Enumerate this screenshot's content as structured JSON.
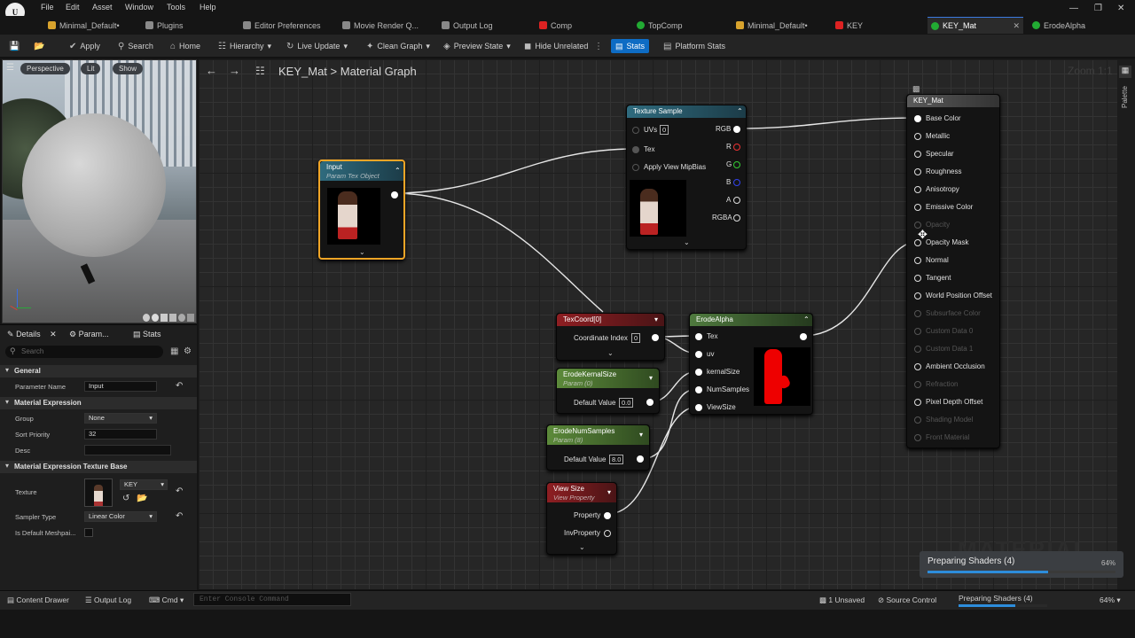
{
  "menu": {
    "items": [
      "File",
      "Edit",
      "Asset",
      "Window",
      "Tools",
      "Help"
    ],
    "logo": "U"
  },
  "tabs": [
    {
      "label": "Minimal_Default•",
      "icon": "level-icon"
    },
    {
      "label": "Plugins",
      "icon": "plug-icon"
    },
    {
      "label": "Editor Preferences",
      "icon": "settings-icon"
    },
    {
      "label": "Movie Render Q...",
      "icon": "movie-icon"
    },
    {
      "label": "Output Log",
      "icon": "log-icon"
    },
    {
      "label": "Comp",
      "icon": "comp-icon"
    },
    {
      "label": "TopComp",
      "icon": "comp-icon"
    },
    {
      "label": "Minimal_Default•",
      "icon": "level-icon"
    },
    {
      "label": "KEY",
      "icon": "comp-icon"
    },
    {
      "label": "KEY_Mat",
      "icon": "material-icon",
      "active": true
    },
    {
      "label": "ErodeAlpha",
      "icon": "material-icon"
    }
  ],
  "toolbar": {
    "apply": "Apply",
    "search": "Search",
    "home": "Home",
    "hierarchy": "Hierarchy",
    "live_update": "Live Update",
    "clean_graph": "Clean Graph",
    "preview_state": "Preview State",
    "hide_unrelated": "Hide Unrelated",
    "stats": "Stats",
    "platform_stats": "Platform Stats"
  },
  "viewport": {
    "perspective": "Perspective",
    "lit": "Lit",
    "show": "Show"
  },
  "details": {
    "tabs": [
      "Details",
      "Param...",
      "Stats"
    ],
    "search_placeholder": "Search",
    "sections": {
      "general": "General",
      "material_expression": "Material Expression",
      "texture_base": "Material Expression Texture Base"
    },
    "props": {
      "parameter_name_label": "Parameter Name",
      "parameter_name": "Input",
      "group_label": "Group",
      "group": "None",
      "sort_priority_label": "Sort Priority",
      "sort_priority": "32",
      "desc_label": "Desc",
      "texture_label": "Texture",
      "texture": "KEY",
      "sampler_label": "Sampler Type",
      "sampler": "Linear Color",
      "default_meshpaint_label": "Is Default Meshpai..."
    }
  },
  "graph": {
    "breadcrumb_root": "KEY_Mat",
    "breadcrumb_sep": ">",
    "breadcrumb_leaf": "Material Graph",
    "zoom": "Zoom 1:1",
    "palette": "Palette"
  },
  "nodes": {
    "input": {
      "title": "Input",
      "subtitle": "Param Tex Object"
    },
    "texture_sample": {
      "title": "Texture Sample",
      "uvs": "UVs",
      "uvs_val": "0",
      "tex": "Tex",
      "mip": "Apply View MipBias",
      "outputs": [
        "RGB",
        "R",
        "G",
        "B",
        "A",
        "RGBA"
      ]
    },
    "texcoord": {
      "title": "TexCoord[0]",
      "coord": "Coordinate Index",
      "coord_val": "0"
    },
    "erode_kernel": {
      "title": "ErodeKernalSize",
      "subtitle": "Param (0)",
      "label": "Default Value",
      "value": "0.0"
    },
    "erode_num": {
      "title": "ErodeNumSamples",
      "subtitle": "Param (8)",
      "label": "Default Value",
      "value": "8.0"
    },
    "view_size": {
      "title": "View Size",
      "subtitle": "View Property",
      "property": "Property",
      "inv": "InvProperty"
    },
    "erode_alpha": {
      "title": "ErodeAlpha",
      "inputs": [
        "Tex",
        "uv",
        "kernalSize",
        "NumSamples",
        "ViewSize"
      ]
    },
    "key_mat": {
      "title": "KEY_Mat",
      "pins": [
        {
          "label": "Base Color",
          "on": true
        },
        {
          "label": "Metallic",
          "on": true
        },
        {
          "label": "Specular",
          "on": true
        },
        {
          "label": "Roughness",
          "on": true
        },
        {
          "label": "Anisotropy",
          "on": true
        },
        {
          "label": "Emissive Color",
          "on": true
        },
        {
          "label": "Opacity",
          "on": false
        },
        {
          "label": "Opacity Mask",
          "on": true
        },
        {
          "label": "Normal",
          "on": true
        },
        {
          "label": "Tangent",
          "on": true
        },
        {
          "label": "World Position Offset",
          "on": true
        },
        {
          "label": "Subsurface Color",
          "on": false
        },
        {
          "label": "Custom Data 0",
          "on": false
        },
        {
          "label": "Custom Data 1",
          "on": false
        },
        {
          "label": "Ambient Occlusion",
          "on": true
        },
        {
          "label": "Refraction",
          "on": false
        },
        {
          "label": "Pixel Depth Offset",
          "on": true
        },
        {
          "label": "Shading Model",
          "on": false
        },
        {
          "label": "Front Material",
          "on": false
        }
      ]
    }
  },
  "toast": {
    "label": "Preparing Shaders (4)",
    "percent": "64%",
    "progress": 0.64
  },
  "bottom": {
    "content_drawer": "Content Drawer",
    "output_log": "Output Log",
    "cmd": "Cmd",
    "console_placeholder": "Enter Console Command",
    "unsaved": "1 Unsaved",
    "source_control": "Source Control",
    "preparing": "Preparing Shaders (4)",
    "percent": "64%",
    "progress": 0.64
  }
}
